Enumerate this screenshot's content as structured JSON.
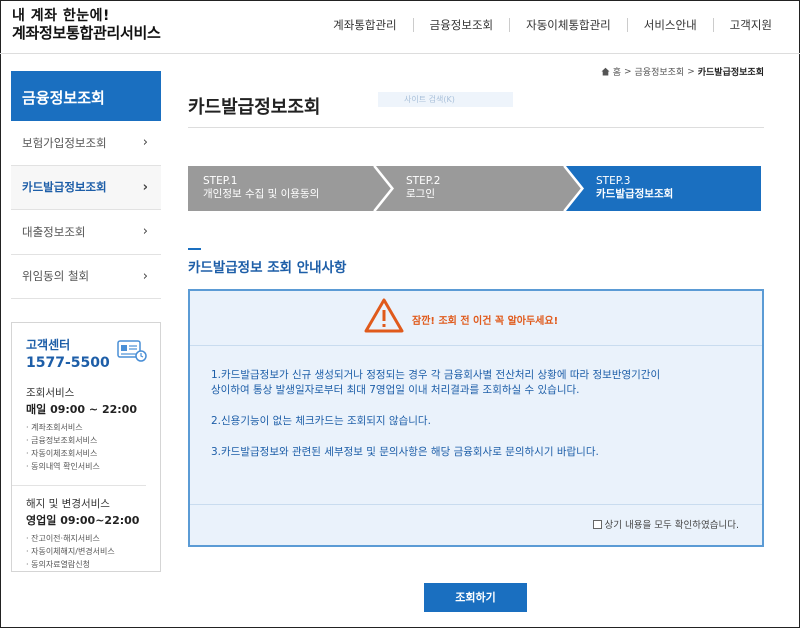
{
  "brand": {
    "line1": "내 계좌 한눈에!",
    "line2": "계좌정보통합관리서비스"
  },
  "gnb": [
    "계좌통합관리",
    "금융정보조회",
    "자동이체통합관리",
    "서비스안내",
    "고객지원"
  ],
  "breadcrumb": {
    "home": "홈",
    "parent": "금융정보조회",
    "current": "카드발급정보조회",
    "sep": ">"
  },
  "sidebar": {
    "title": "금융정보조회",
    "items": [
      {
        "label": "보험가입정보조회"
      },
      {
        "label": "카드발급정보조회"
      },
      {
        "label": "대출정보조회"
      },
      {
        "label": "위임동의 철회"
      }
    ],
    "chevron": "›"
  },
  "cs": {
    "title": "고객센터",
    "phone": "1577-5500",
    "inquiry_title": "조회서비스",
    "inquiry_hours": "매일 09:00 ~ 22:00",
    "inquiry_list": [
      "계좌조회서비스",
      "금융정보조회서비스",
      "자동이체조회서비스",
      "동의내역 확인서비스"
    ],
    "change_title": "해지 및 변경서비스",
    "change_hours": "영업일 09:00~22:00",
    "change_list": [
      "잔고이전·해지서비스",
      "자동이체해지/변경서비스",
      "동의자료열람신청"
    ]
  },
  "page": {
    "title": "카드발급정보조회",
    "search_placeholder": "사이트 검색(K)"
  },
  "steps": [
    {
      "num": "STEP.1",
      "label": "개인정보 수집 및 이용동의"
    },
    {
      "num": "STEP.2",
      "label": "로그인"
    },
    {
      "num": "STEP.3",
      "label": "카드발급정보조회"
    }
  ],
  "section": {
    "title": "카드발급정보 조회 안내사항"
  },
  "notice": {
    "warning": "잠깐! 조회 전 이건 꼭 알아두세요!",
    "p1a": "1.카드발급정보가 신규 생성되거나 정정되는 경우 각 금융회사별 전산처리 상황에 따라 정보반영기간이",
    "p1b": "상이하여 통상 발생일자로부터 최대 7영업일 이내 처리결과를 조회하실 수 있습니다.",
    "p2": "2.신용기능이 없는 체크카드는 조회되지 않습니다.",
    "p3": "3.카드발급정보와 관련된 세부정보 및 문의사항은 해당 금융회사로 문의하시기 바랍니다.",
    "agree": "상기 내용을 모두 확인하였습니다."
  },
  "button": {
    "submit": "조회하기"
  },
  "colors": {
    "primary": "#1a6fc0",
    "step_inactive": "#9a9a9a",
    "warning": "#e05a1b"
  }
}
